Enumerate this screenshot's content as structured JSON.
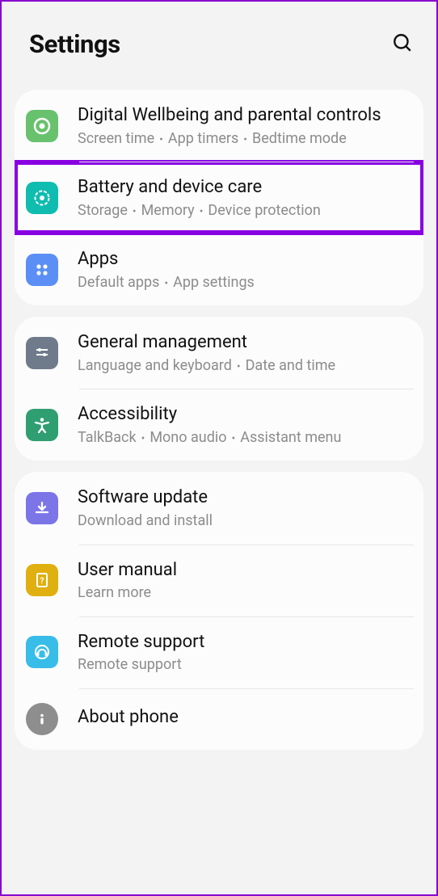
{
  "header": {
    "title": "Settings"
  },
  "groups": [
    {
      "items": [
        {
          "icon": "wellbeing-icon",
          "color": "bg-green",
          "title": "Digital Wellbeing and parental controls",
          "subtitle": [
            "Screen time",
            "App timers",
            "Bedtime mode"
          ],
          "highlight": false
        },
        {
          "icon": "device-care-icon",
          "color": "bg-teal",
          "title": "Battery and device care",
          "subtitle": [
            "Storage",
            "Memory",
            "Device protection"
          ],
          "highlight": true
        },
        {
          "icon": "apps-icon",
          "color": "bg-blue",
          "title": "Apps",
          "subtitle": [
            "Default apps",
            "App settings"
          ],
          "highlight": false
        }
      ]
    },
    {
      "items": [
        {
          "icon": "general-mgmt-icon",
          "color": "bg-slate",
          "title": "General management",
          "subtitle": [
            "Language and keyboard",
            "Date and time"
          ],
          "highlight": false
        },
        {
          "icon": "accessibility-icon",
          "color": "bg-emerald",
          "title": "Accessibility",
          "subtitle": [
            "TalkBack",
            "Mono audio",
            "Assistant menu"
          ],
          "highlight": false
        }
      ]
    },
    {
      "items": [
        {
          "icon": "software-update-icon",
          "color": "bg-violet",
          "title": "Software update",
          "subtitle": [
            "Download and install"
          ],
          "highlight": false
        },
        {
          "icon": "user-manual-icon",
          "color": "bg-gold",
          "title": "User manual",
          "subtitle": [
            "Learn more"
          ],
          "highlight": false
        },
        {
          "icon": "remote-support-icon",
          "color": "bg-cyan",
          "title": "Remote support",
          "subtitle": [
            "Remote support"
          ],
          "highlight": false
        },
        {
          "icon": "about-phone-icon",
          "color": "bg-grey round",
          "title": "About phone",
          "subtitle": [],
          "highlight": false
        }
      ]
    }
  ]
}
